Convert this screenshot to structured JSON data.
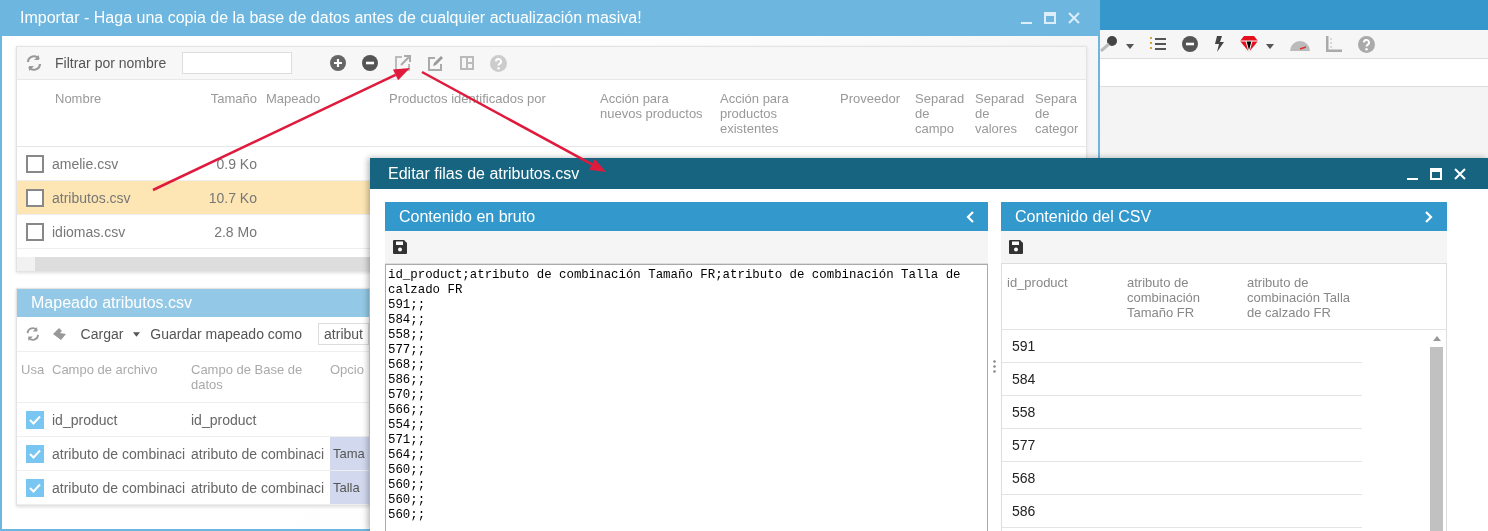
{
  "import_window": {
    "title": "Importar - Haga una copia de la base de datos antes de cualquier actualización masiva!",
    "files": {
      "filter_label": "Filtrar por nombre",
      "columns": [
        "Nombre",
        "Tamaño",
        "Mapeado",
        "Productos identificados por",
        "Acción para\nnuevos productos",
        "Acción para\nproductos\nexistentes",
        "Proveedor",
        "Separad\nde\ncampo",
        "Separad\nde\nvalores",
        "Separa\nde\ncategor"
      ],
      "rows": [
        {
          "name": "amelie.csv",
          "size": "0.9 Ko",
          "checked": false,
          "selected": false
        },
        {
          "name": "atributos.csv",
          "size": "10.7 Ko",
          "checked": false,
          "selected": true
        },
        {
          "name": "idiomas.csv",
          "size": "2.8 Mo",
          "checked": false,
          "selected": false
        }
      ]
    },
    "mapping": {
      "title": "Mapeado atributos.csv",
      "load_label": "Cargar",
      "save_as_label": "Guardar mapeado como",
      "save_as_value": "atribut",
      "columns": [
        "Usa",
        "Campo de archivo",
        "Campo de Base de datos",
        "Opcio"
      ],
      "rows": [
        {
          "used": true,
          "file_field": "id_product",
          "db_field": "id_product"
        },
        {
          "used": true,
          "file_field": "atributo de combinaci",
          "db_field": "atributo de combinaci",
          "option": "Tama"
        },
        {
          "used": true,
          "file_field": "atributo de combinaci",
          "db_field": "atributo de combinaci",
          "option": "Talla"
        }
      ]
    }
  },
  "edit_window": {
    "title": "Editar filas de atributos.csv",
    "raw_panel": {
      "title": "Contenido en bruto",
      "lines": [
        "id_product;atributo de combinación Tamaño FR;atributo de combinación Talla de calzado FR",
        "591;;",
        "584;;",
        "558;;",
        "577;;",
        "568;;",
        "586;;",
        "570;;",
        "566;;",
        "554;;",
        "571;;",
        "564;;",
        "560;;",
        "560;;",
        "560;;",
        "560;;"
      ]
    },
    "csv_panel": {
      "title": "Contenido del CSV",
      "columns": [
        "id_product",
        "atributo de combinación Tamaño FR",
        "atributo de combinación Talla de calzado FR"
      ],
      "rows": [
        "591",
        "584",
        "558",
        "577",
        "568",
        "586"
      ]
    }
  }
}
